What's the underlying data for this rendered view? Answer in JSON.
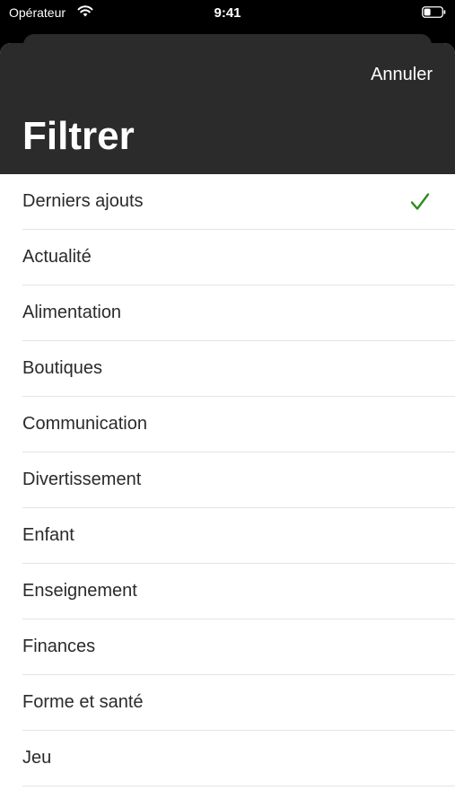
{
  "status_bar": {
    "carrier": "Opérateur",
    "time": "9:41",
    "wifi_icon": "wifi-icon",
    "battery_icon": "battery-icon"
  },
  "header": {
    "cancel_label": "Annuler",
    "title": "Filtrer",
    "background_color": "#2b2b2b"
  },
  "filter_list": {
    "selected_index": 0,
    "check_color": "#2e8b1e",
    "items": [
      {
        "label": "Derniers ajouts",
        "selected": true
      },
      {
        "label": "Actualité",
        "selected": false
      },
      {
        "label": "Alimentation",
        "selected": false
      },
      {
        "label": "Boutiques",
        "selected": false
      },
      {
        "label": "Communication",
        "selected": false
      },
      {
        "label": "Divertissement",
        "selected": false
      },
      {
        "label": "Enfant",
        "selected": false
      },
      {
        "label": "Enseignement",
        "selected": false
      },
      {
        "label": "Finances",
        "selected": false
      },
      {
        "label": "Forme et santé",
        "selected": false
      },
      {
        "label": "Jeu",
        "selected": false
      }
    ]
  }
}
